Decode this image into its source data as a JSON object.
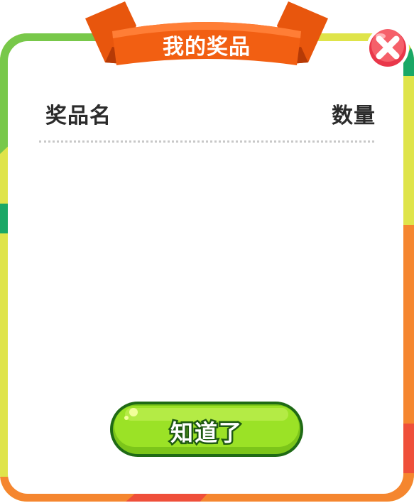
{
  "dialog": {
    "title": "我的奖品",
    "close_icon": "close-x-icon"
  },
  "table": {
    "columns": [
      "奖品名",
      "数量"
    ],
    "rows": []
  },
  "confirm_button": {
    "label": "知道了"
  },
  "colors": {
    "ribbon": "#f0590f",
    "ribbon_dark": "#c63d05",
    "close_button": "#f04f5a",
    "confirm_button": "#8cd81e",
    "confirm_outline": "#1f6a15",
    "frame_green": "#78c84a",
    "frame_yellow": "#dfe44a",
    "frame_orange": "#f5862f",
    "frame_teal": "#1aa866",
    "frame_red": "#ef4f3a"
  }
}
